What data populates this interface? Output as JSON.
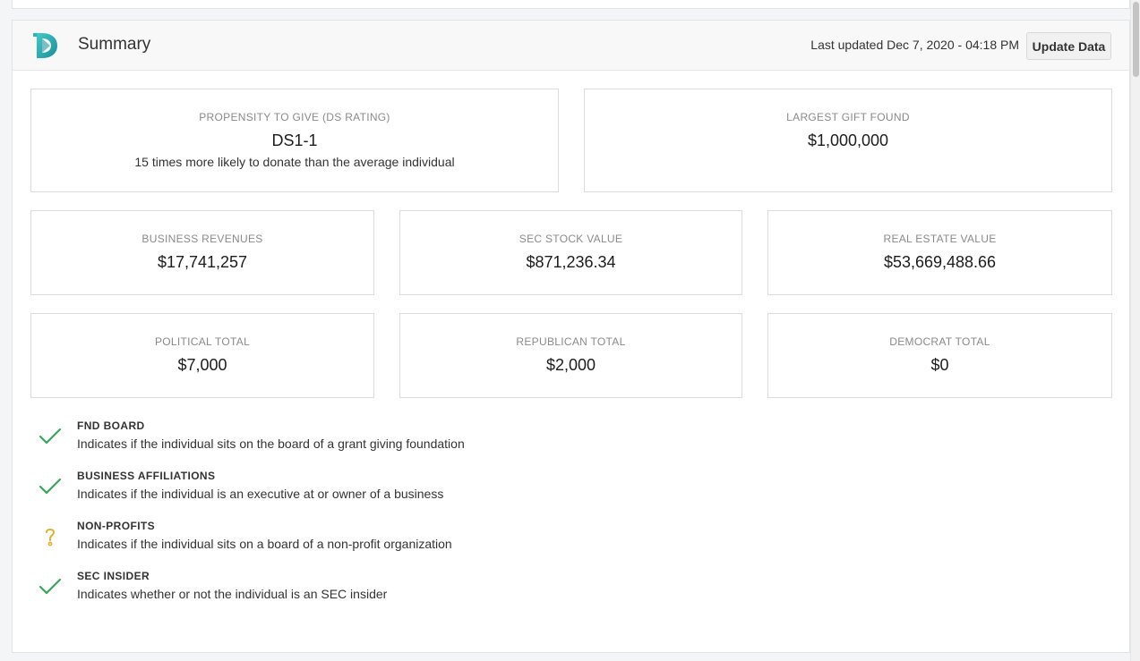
{
  "header": {
    "title": "Summary",
    "last_updated": "Last updated Dec 7, 2020 - 04:18 PM",
    "update_button": "Update Data"
  },
  "propensity": {
    "label": "PROPENSITY TO GIVE (DS RATING)",
    "value": "DS1-1",
    "note": "15 times more likely to donate than the average individual"
  },
  "largest_gift": {
    "label": "LARGEST GIFT FOUND",
    "value": "$1,000,000"
  },
  "metrics": [
    {
      "label": "BUSINESS REVENUES",
      "value": "$17,741,257"
    },
    {
      "label": "SEC STOCK VALUE",
      "value": "$871,236.34"
    },
    {
      "label": "REAL ESTATE VALUE",
      "value": "$53,669,488.66"
    },
    {
      "label": "POLITICAL TOTAL",
      "value": "$7,000"
    },
    {
      "label": "REPUBLICAN TOTAL",
      "value": "$2,000"
    },
    {
      "label": "DEMOCRAT TOTAL",
      "value": "$0"
    }
  ],
  "indicators": [
    {
      "title": "FND BOARD",
      "description": "Indicates if the individual sits on the board of a grant giving foundation",
      "status": "check"
    },
    {
      "title": "BUSINESS AFFILIATIONS",
      "description": "Indicates if the individual is an executive at or owner of a business",
      "status": "check"
    },
    {
      "title": "NON-PROFITS",
      "description": "Indicates if the individual sits on a board of a non-profit organization",
      "status": "unknown"
    },
    {
      "title": "SEC INSIDER",
      "description": "Indicates whether or not the individual is an SEC insider",
      "status": "check"
    }
  ],
  "icons": {
    "logo": "ds-logo-icon",
    "check": "check-icon",
    "unknown": "question-mark-icon"
  },
  "colors": {
    "check": "#3aa35a",
    "unknown": "#e0b12a",
    "logo": "#2bb5b3"
  }
}
